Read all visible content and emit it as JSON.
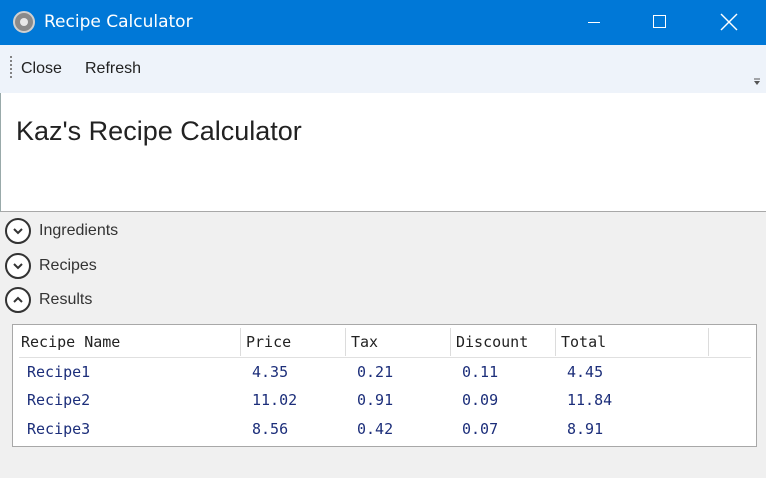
{
  "window": {
    "title": "Recipe Calculator",
    "icon": "app-icon",
    "controls": [
      "minimize",
      "maximize",
      "close"
    ],
    "accent_color": "#0078d7"
  },
  "toolbar": {
    "close_label": "Close",
    "refresh_label": "Refresh"
  },
  "header": {
    "title": "Kaz's Recipe Calculator"
  },
  "expanders": [
    {
      "label": "Ingredients",
      "expanded": false
    },
    {
      "label": "Recipes",
      "expanded": false
    },
    {
      "label": "Results",
      "expanded": true
    }
  ],
  "results": {
    "columns": [
      "Recipe Name",
      "Price",
      "Tax",
      "Discount",
      "Total"
    ],
    "rows": [
      [
        "Recipe1",
        "4.35",
        "0.21",
        "0.11",
        "4.45"
      ],
      [
        "Recipe2",
        "11.02",
        "0.91",
        "0.09",
        "11.84"
      ],
      [
        "Recipe3",
        "8.56",
        "0.42",
        "0.07",
        "8.91"
      ]
    ],
    "cell_text_color": "#1c2e7a"
  }
}
